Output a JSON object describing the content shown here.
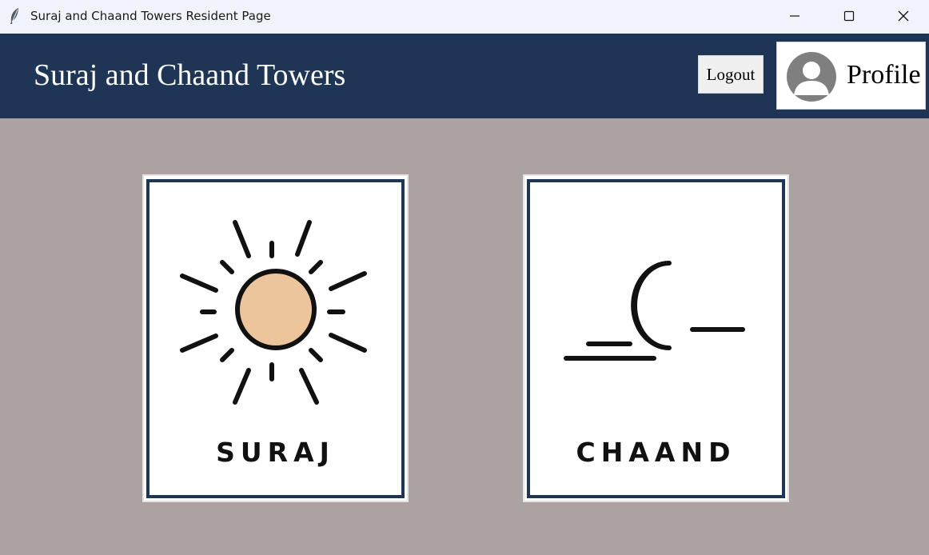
{
  "window": {
    "title": "Suraj and Chaand Towers Resident Page",
    "icons": {
      "app": "feather-icon",
      "minimize": "minimize-icon",
      "maximize": "maximize-icon",
      "close": "close-icon"
    }
  },
  "header": {
    "title": "Suraj and Chaand Towers",
    "logout_label": "Logout",
    "profile_label": "Profile",
    "profile_icon": "user-avatar-icon"
  },
  "towers": [
    {
      "label": "SURAJ",
      "icon": "sun-icon"
    },
    {
      "label": "CHAAND",
      "icon": "moon-icon"
    }
  ],
  "colors": {
    "header_bg": "#1e3556",
    "page_bg": "#aba3a2",
    "card_border": "#1e3556",
    "sun_fill": "#ecc59c",
    "moon_fill": "#e2dde8"
  }
}
